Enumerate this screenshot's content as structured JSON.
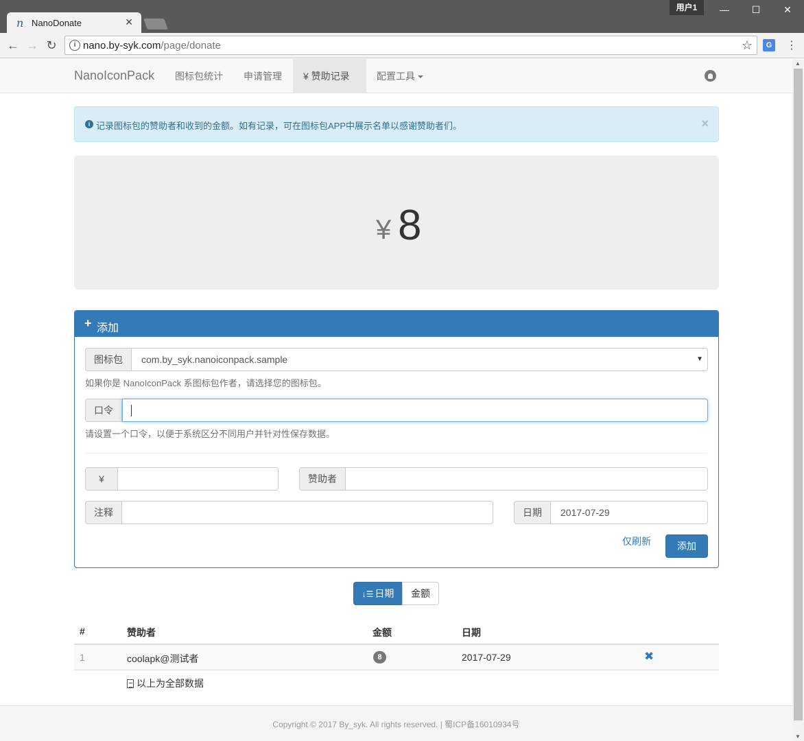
{
  "browser": {
    "tab_title": "NanoDonate",
    "tab_favicon": "n",
    "user_badge": "用户1",
    "url_host": "nano.by-syk.com",
    "url_path": "/page/donate"
  },
  "navbar": {
    "brand": "NanoIconPack",
    "items": [
      {
        "label": "图标包统计",
        "active": false
      },
      {
        "label": "申请管理",
        "active": false
      },
      {
        "label": "¥  赞助记录",
        "active": true
      },
      {
        "label": "配置工具",
        "active": false
      }
    ],
    "github_icon": "github-icon"
  },
  "alert": {
    "text": "记录图标包的赞助者和收到的金额。如有记录，可在图标包APP中展示名单以感谢赞助者们。",
    "close": "×"
  },
  "total": {
    "currency": "¥",
    "amount": "8"
  },
  "form": {
    "title": "添加",
    "iconpack_label": "图标包",
    "iconpack_value": "com.by_syk.nanoiconpack.sample",
    "iconpack_help": "如果你是 NanoIconPack 系图标包作者，请选择您的图标包。",
    "password_label": "口令",
    "password_value": "",
    "password_help": "请设置一个口令，以便于系统区分不同用户并针对性保存数据。",
    "amount_label": "¥",
    "amount_value": "",
    "donor_label": "赞助者",
    "donor_value": "",
    "note_label": "注释",
    "note_value": "",
    "date_label": "日期",
    "date_value": "2017-07-29",
    "refresh_label": "仅刷新",
    "submit_label": "添加"
  },
  "sort": {
    "date_label": "日期",
    "amount_label": "金额",
    "active": "date"
  },
  "table": {
    "headers": [
      "#",
      "赞助者",
      "金额",
      "日期"
    ],
    "rows": [
      {
        "index": "1",
        "donor": "coolapk@测试者",
        "amount": "8",
        "date": "2017-07-29"
      }
    ],
    "footnote": "以上为全部数据"
  },
  "footer": {
    "text": "Copyright © 2017 By_syk. All rights reserved. | 蜀ICP备16010934号"
  },
  "colors": {
    "primary": "#337ab7",
    "info_bg": "#d9edf7",
    "info_text": "#31708f"
  }
}
